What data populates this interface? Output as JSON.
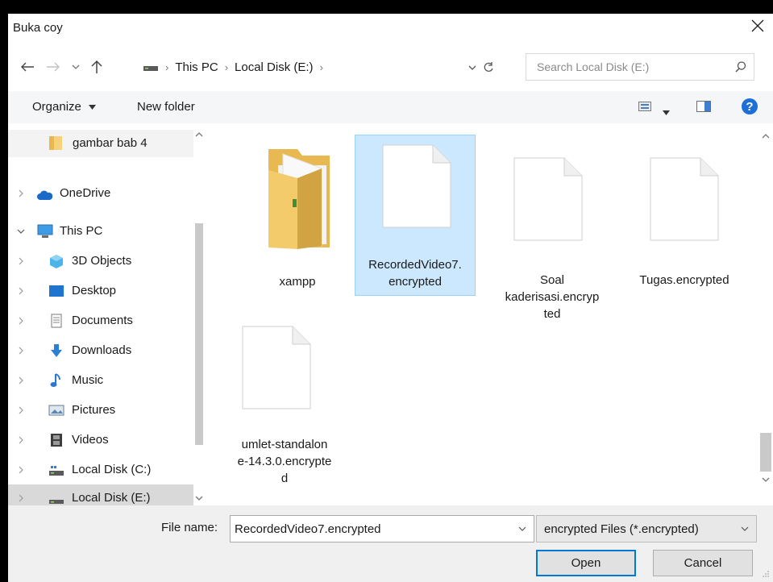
{
  "window": {
    "title": "Buka coy"
  },
  "address": {
    "crumbs": [
      "This PC",
      "Local Disk (E:)"
    ]
  },
  "search": {
    "placeholder": "Search Local Disk (E:)"
  },
  "toolbar": {
    "organize": "Organize",
    "new_folder": "New folder"
  },
  "sidebar": {
    "items": [
      {
        "label": "gambar bab 4",
        "icon": "folder-icon"
      },
      {
        "label": "OneDrive",
        "icon": "cloud-icon"
      },
      {
        "label": "This PC",
        "icon": "computer-icon"
      },
      {
        "label": "3D Objects",
        "icon": "cube-icon"
      },
      {
        "label": "Desktop",
        "icon": "desktop-icon"
      },
      {
        "label": "Documents",
        "icon": "document-icon"
      },
      {
        "label": "Downloads",
        "icon": "download-icon"
      },
      {
        "label": "Music",
        "icon": "music-icon"
      },
      {
        "label": "Pictures",
        "icon": "pictures-icon"
      },
      {
        "label": "Videos",
        "icon": "video-icon"
      },
      {
        "label": "Local Disk (C:)",
        "icon": "drive-icon"
      },
      {
        "label": "Local Disk (E:)",
        "icon": "drive-icon"
      }
    ]
  },
  "files": [
    {
      "name": "xampp",
      "type": "folder"
    },
    {
      "name": "RecordedVideo7.encrypted",
      "lines": [
        "RecordedVideo7.",
        "encrypted"
      ],
      "type": "file",
      "selected": true
    },
    {
      "name": "Soal kaderisasi.encrypted",
      "lines": [
        "Soal",
        "kaderisasi.encryp",
        "ted"
      ],
      "type": "file"
    },
    {
      "name": "Tugas.encrypted",
      "lines": [
        "Tugas.encrypted"
      ],
      "type": "file"
    },
    {
      "name": "umlet-standalone-14.3.0.encrypted",
      "lines": [
        "umlet-standalon",
        "e-14.3.0.encrypte",
        "d"
      ],
      "type": "file"
    }
  ],
  "bottom": {
    "file_name_label": "File name:",
    "file_name_value": "RecordedVideo7.encrypted",
    "file_type": "encrypted Files (*.encrypted)",
    "open_label": "Open",
    "cancel_label": "Cancel"
  },
  "colors": {
    "selection": "#cce8ff",
    "selection_border": "#99d1ff",
    "accent": "#0078d7"
  }
}
